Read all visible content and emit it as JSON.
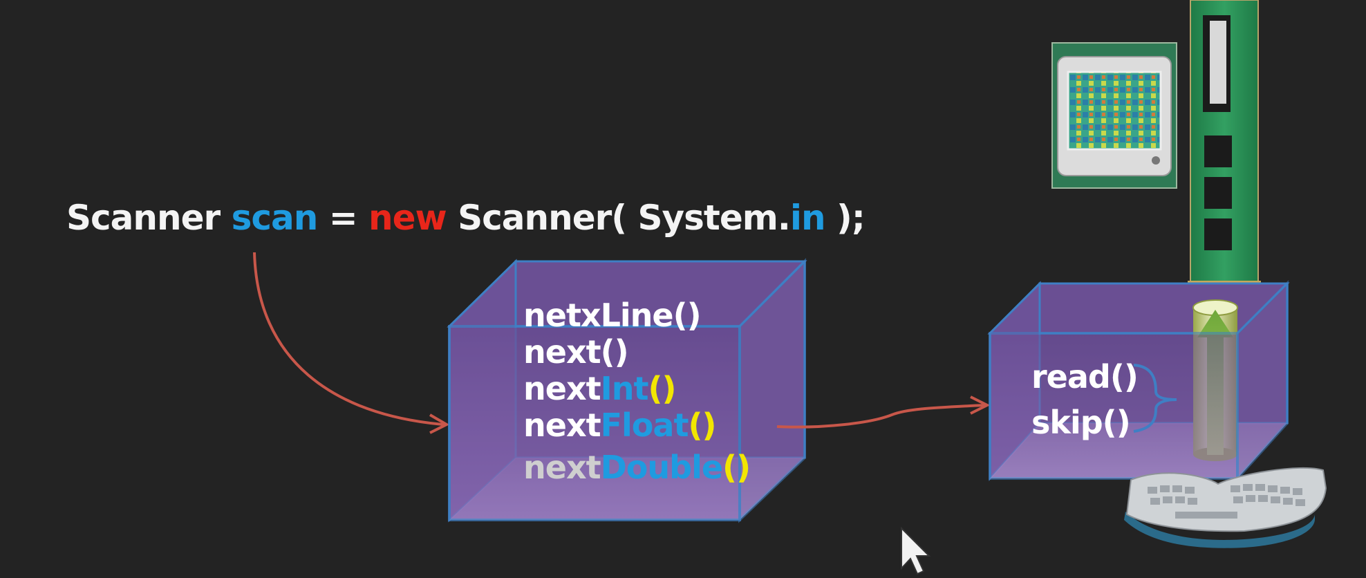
{
  "code": {
    "part1": "Scanner ",
    "scan": "scan",
    "part2": " = ",
    "new": "new",
    "part3": " Scanner( System.",
    "in": "in",
    "part4": " );"
  },
  "scanner_methods": {
    "netxLine": "netxLine()",
    "next": "next()",
    "nextInt_prefix": "next",
    "nextInt_type": "Int",
    "nextInt_parens": "()",
    "nextFloat_prefix": "next",
    "nextFloat_type": "Float",
    "nextFloat_parens": "()",
    "nextDouble_prefix": "next",
    "nextDouble_type": "Double",
    "nextDouble_parens": "()"
  },
  "inputstream_methods": {
    "read": "read()",
    "skip": "skip()"
  },
  "colors": {
    "background": "#232323",
    "keyword_blue": "#1f9be0",
    "keyword_red": "#e8261a",
    "paren_yellow": "#f2e600",
    "arrow": "#c8574a",
    "box_fill": "#7a5aa6",
    "box_edge": "#3f7fc4"
  },
  "icons": [
    "cpu-chip-icon",
    "ram-module-icon",
    "keyboard-icon",
    "cylinder-icon",
    "mouse-cursor-icon"
  ]
}
